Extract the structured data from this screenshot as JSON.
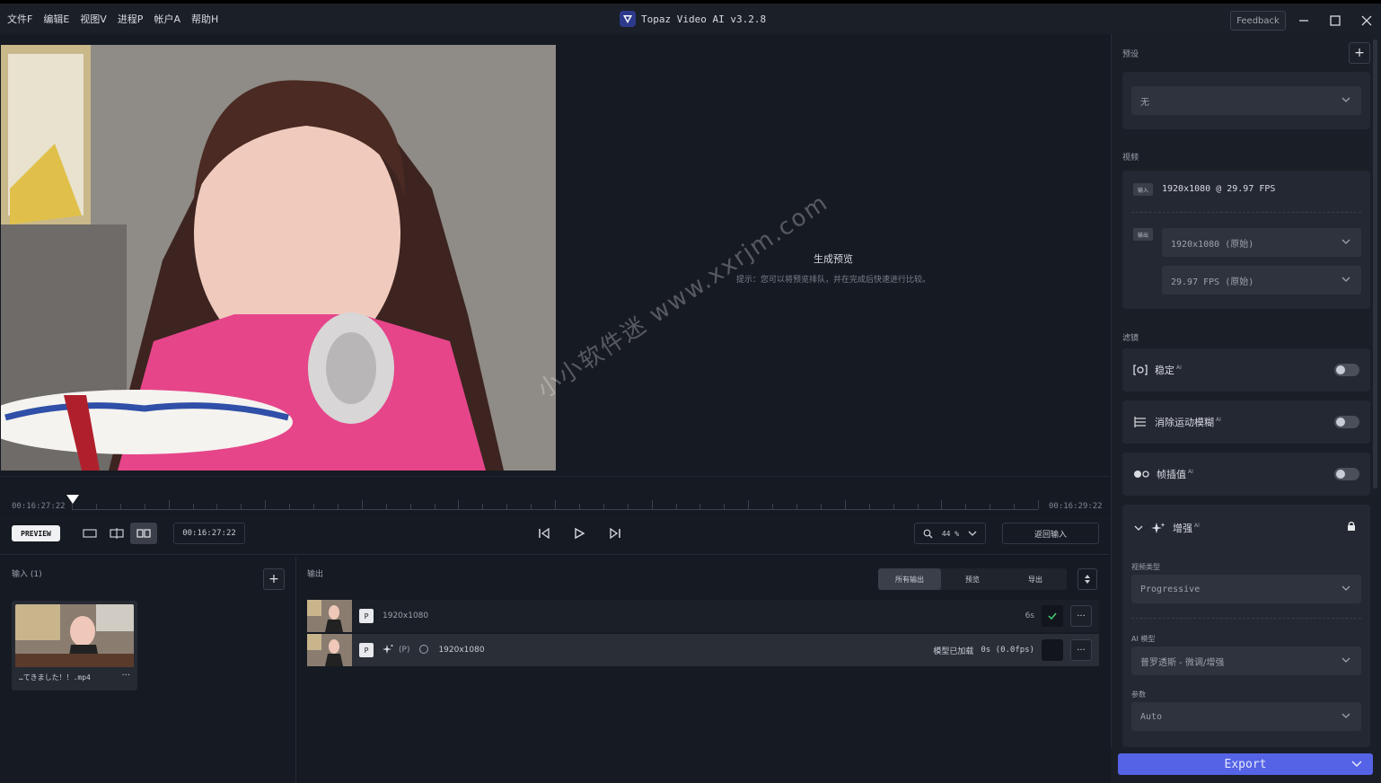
{
  "menu": [
    "文件F",
    "编辑E",
    "视图V",
    "进程P",
    "帐户A",
    "帮助H"
  ],
  "app_title": "Topaz Video AI  v3.2.8",
  "feedback_label": "Feedback",
  "preview": {
    "gen_title": "生成预览",
    "gen_hint": "提示：您可以将预览排队，并在完成后快速进行比较。"
  },
  "timeline": {
    "start_tc": "00:16:27:22",
    "end_tc": "00:16:29:22"
  },
  "controls": {
    "preview_label": "PREVIEW",
    "timecode": "00:16:27:22",
    "zoom": "44 %",
    "return_label": "返回输入"
  },
  "input": {
    "title": "输入 (1)",
    "file_name": "…てきました！！.mp4",
    "more": "···"
  },
  "output": {
    "title": "输出",
    "tabs": [
      "所有输出",
      "预览",
      "导出"
    ],
    "rows": [
      {
        "badge": "P",
        "resolution": "1920x1080",
        "time": "6s"
      },
      {
        "badge": "P",
        "mode": "(P)",
        "resolution": "1920x1080",
        "status": "模型已加载",
        "time": "0s (0.0fps)"
      }
    ]
  },
  "right": {
    "preset_label": "预设",
    "preset_value": "无",
    "video_label": "视频",
    "input_tag": "输入",
    "input_info": "1920x1080 @ 29.97 FPS",
    "output_tag": "输出",
    "output_res": "1920x1080 (原始)",
    "output_fps": "29.97 FPS (原始)",
    "filter_label": "滤镜",
    "filters": [
      {
        "name": "稳定",
        "ai": "AI"
      },
      {
        "name": "消除运动模糊",
        "ai": "AI"
      },
      {
        "name": "帧插值",
        "ai": "AI"
      }
    ],
    "enhance": {
      "name": "增强",
      "ai": "AI",
      "video_type_label": "视频类型",
      "video_type": "Progressive",
      "model_label": "AI 模型",
      "model": "普罗透斯 - 微调/增强",
      "param_label": "参数",
      "param": "Auto"
    },
    "export_label": "Export"
  },
  "watermark": "小小软件迷 www.xxrjm.com"
}
